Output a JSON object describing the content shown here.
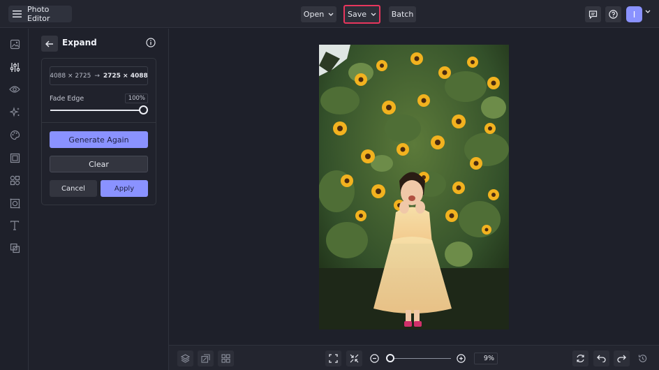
{
  "header": {
    "app_title": "Photo Editor",
    "open_label": "Open",
    "save_label": "Save",
    "batch_label": "Batch",
    "avatar_initial": "I"
  },
  "rail": {
    "items": [
      "image-icon",
      "sliders-icon",
      "eye-icon",
      "sparkles-icon",
      "palette-icon",
      "frame-icon",
      "shapes-icon",
      "texture-icon",
      "text-icon",
      "overlay-icon"
    ]
  },
  "panel": {
    "title": "Expand",
    "dims_from": "4088 × 2725",
    "dims_arrow": "→",
    "dims_to": "2725 × 4088",
    "fade_label": "Fade Edge",
    "fade_value": "100%",
    "fade_level": 1.0,
    "generate_label": "Generate Again",
    "clear_label": "Clear",
    "cancel_label": "Cancel",
    "apply_label": "Apply"
  },
  "footer": {
    "zoom_value": "9%",
    "zoom_level": 0.0
  },
  "colors": {
    "accent": "#8a92ff",
    "highlight": "#e8365d",
    "background": "#1e202a"
  }
}
